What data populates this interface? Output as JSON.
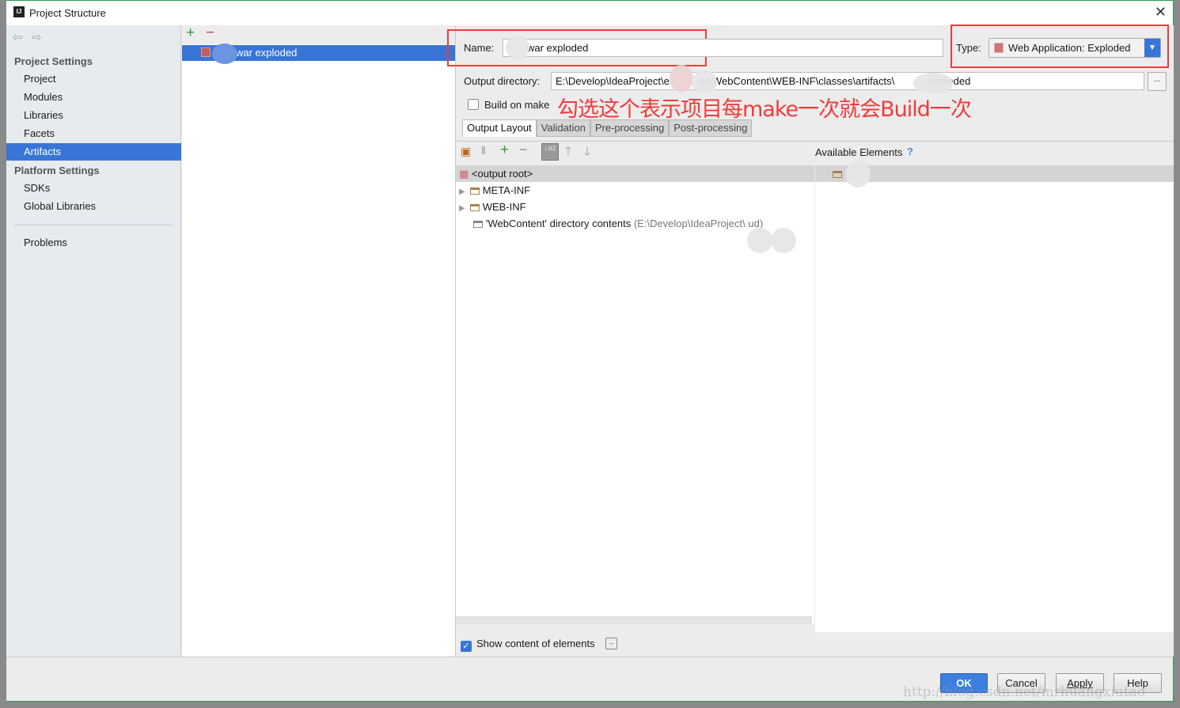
{
  "window": {
    "title": "Project Structure",
    "close_icon": "close-icon"
  },
  "sidebar": {
    "project_settings": "Project Settings",
    "items": [
      {
        "label": "Project"
      },
      {
        "label": "Modules"
      },
      {
        "label": "Libraries"
      },
      {
        "label": "Facets"
      },
      {
        "label": "Artifacts",
        "selected": true
      }
    ],
    "platform_settings": "Platform Settings",
    "platform_items": [
      {
        "label": "SDKs"
      },
      {
        "label": "Global Libraries"
      }
    ],
    "problems": "Problems"
  },
  "artifacts": {
    "items": [
      {
        "label": "war exploded",
        "selected": true
      }
    ]
  },
  "form": {
    "name_label": "Name:",
    "name_value": "war exploded",
    "type_label": "Type:",
    "type_value": "Web Application: Exploded",
    "output_label": "Output directory:",
    "output_value": "E:\\Develop\\IdeaProject\\e          ud\\WebContent\\WEB-INF\\classes\\artifacts\\          _exploded",
    "build_on_make": "Build on make",
    "build_on_make_checked": false,
    "annotation": "勾选这个表示项目每make一次就会Build一次",
    "annotation_color": "#f03b3b"
  },
  "tabs": [
    {
      "label": "Output Layout",
      "active": true
    },
    {
      "label": "Validation"
    },
    {
      "label": "Pre-processing"
    },
    {
      "label": "Post-processing"
    }
  ],
  "layout": {
    "available_elements": "Available Elements",
    "help": "?",
    "tree": [
      {
        "label": "<output root>"
      },
      {
        "label": "META-INF"
      },
      {
        "label": "WEB-INF"
      },
      {
        "label": "'WebContent' directory contents",
        "detail": "(E:\\Develop\\IdeaProject\\        ud)"
      }
    ],
    "show_content": "Show content of elements",
    "show_content_checked": true
  },
  "buttons": {
    "ok": "OK",
    "cancel": "Cancel",
    "apply": "Apply",
    "help": "Help"
  },
  "watermark": "http://blog.csdn.net/mrhuangxiutao",
  "colors": {
    "accent": "#3875d7",
    "annotation": "#f03b3b"
  }
}
